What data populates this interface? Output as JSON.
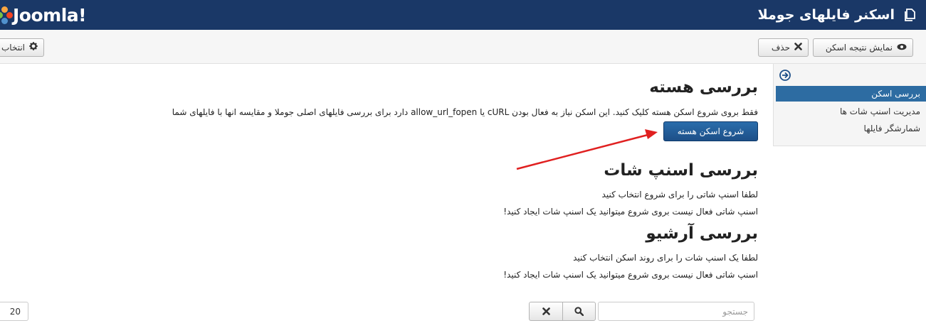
{
  "header": {
    "logo_text": "Joomla!",
    "page_title": "اسکنر فایلهای جوملا"
  },
  "toolbar": {
    "show_results_label": "نمایش نتیجه اسکن",
    "delete_label": "حذف",
    "options_label": "انتخاب"
  },
  "sidebar": {
    "items": [
      {
        "label": "بررسی اسکن",
        "active": true
      },
      {
        "label": "مدیریت اسنپ شات ها",
        "active": false
      },
      {
        "label": "شمارشگر فایلها",
        "active": false
      }
    ]
  },
  "core_check": {
    "title": "بررسی هسته",
    "description": "فقط بروی شروع اسکن هسته کلیک کنید. این اسکن نیاز به فعال بودن cURL یا allow_url_fopen دارد برای بررسی فایلهای اصلی جوملا و مقایسه انها با فایلهای شما",
    "button_label": "شروع اسکن هسته"
  },
  "snapshot_check": {
    "title": "بررسی اسنپ شات",
    "line1": "لطفا اسنپ شاتی را برای شروع انتخاب کنید",
    "line2": "اسنپ شاتی فعال نیست بروی شروع میتوانید یک اسنپ شات ایجاد کنید!"
  },
  "archive_check": {
    "title": "بررسی آرشیو",
    "line1": "لطفا یک اسنپ شات را برای روند اسکن انتخاب کنید",
    "line2": "اسنپ شاتی فعال نیست بروی شروع میتوانید یک اسنپ شات ایجاد کنید!"
  },
  "search": {
    "placeholder": "جستجو"
  },
  "pagination": {
    "limit": "20"
  },
  "colors": {
    "header_bg": "#1a3867",
    "active_item": "#2d6ca2",
    "primary_button": "#1d4f88",
    "annotation_arrow": "#e02020"
  },
  "icons": {
    "page_title": "copy-icon",
    "show_results": "eye-icon",
    "delete": "close-icon",
    "options": "gear-icon",
    "sidebar_toggle": "circle-arrow-right-icon",
    "search": "search-icon",
    "clear": "close-icon"
  }
}
